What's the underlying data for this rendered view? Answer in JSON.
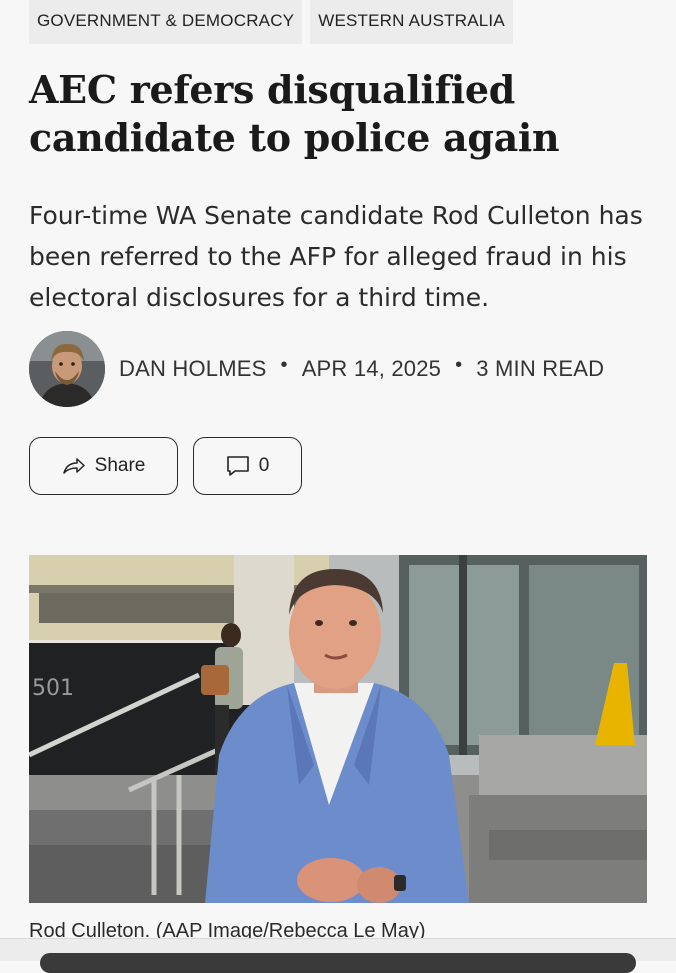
{
  "tags": [
    "GOVERNMENT & DEMOCRACY",
    "WESTERN AUSTRALIA"
  ],
  "headline": "AEC refers disqualified candidate to police again",
  "standfirst": "Four-time WA Senate candidate Rod Culleton has been referred to the AFP for alleged fraud in his electoral disclosures for a third time.",
  "byline": {
    "author": "DAN HOLMES",
    "date": "APR 14, 2025",
    "read_time": "3 MIN READ"
  },
  "actions": {
    "share_label": "Share",
    "comment_count": "0"
  },
  "photo": {
    "building_number": "501"
  },
  "caption": "Rod Culleton. (AAP Image/Rebecca Le May)",
  "icons": {
    "share": "share-arrow-icon",
    "comment": "comment-bubble-icon"
  }
}
